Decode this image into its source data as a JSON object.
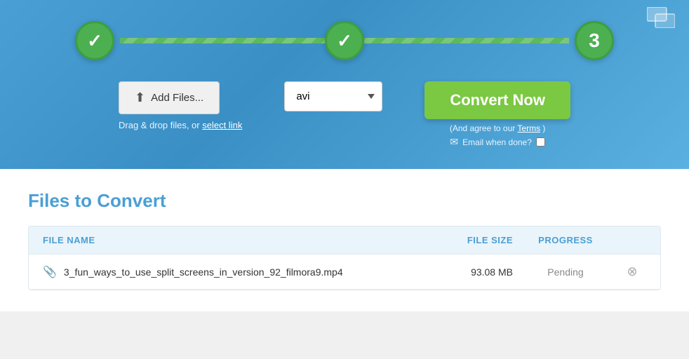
{
  "top": {
    "steps": [
      {
        "id": 1,
        "type": "check",
        "label": "Step 1"
      },
      {
        "id": 2,
        "type": "check",
        "label": "Step 2"
      },
      {
        "id": 3,
        "type": "number",
        "value": "3",
        "label": "Step 3"
      }
    ],
    "add_files_btn": "Add Files...",
    "drag_drop_text": "Drag & drop files, or",
    "select_link_text": "select link",
    "format_value": "avi",
    "convert_now_btn": "Convert Now",
    "terms_text": "(And agree to our",
    "terms_link": "Terms",
    "terms_close": ")",
    "email_icon": "✉",
    "email_label": "Email when done?",
    "checkbox_symbol": "☑"
  },
  "bottom": {
    "title_plain": "Files to",
    "title_colored": "Convert",
    "table": {
      "headers": {
        "filename": "FILE NAME",
        "filesize": "FILE SIZE",
        "progress": "PROGRESS"
      },
      "rows": [
        {
          "filename": "3_fun_ways_to_use_split_screens_in_version_92_filmora9.mp4",
          "filesize": "93.08 MB",
          "progress": "Pending"
        }
      ]
    }
  },
  "icons": {
    "upload": "⬆",
    "clip": "📎",
    "remove": "⊗"
  }
}
